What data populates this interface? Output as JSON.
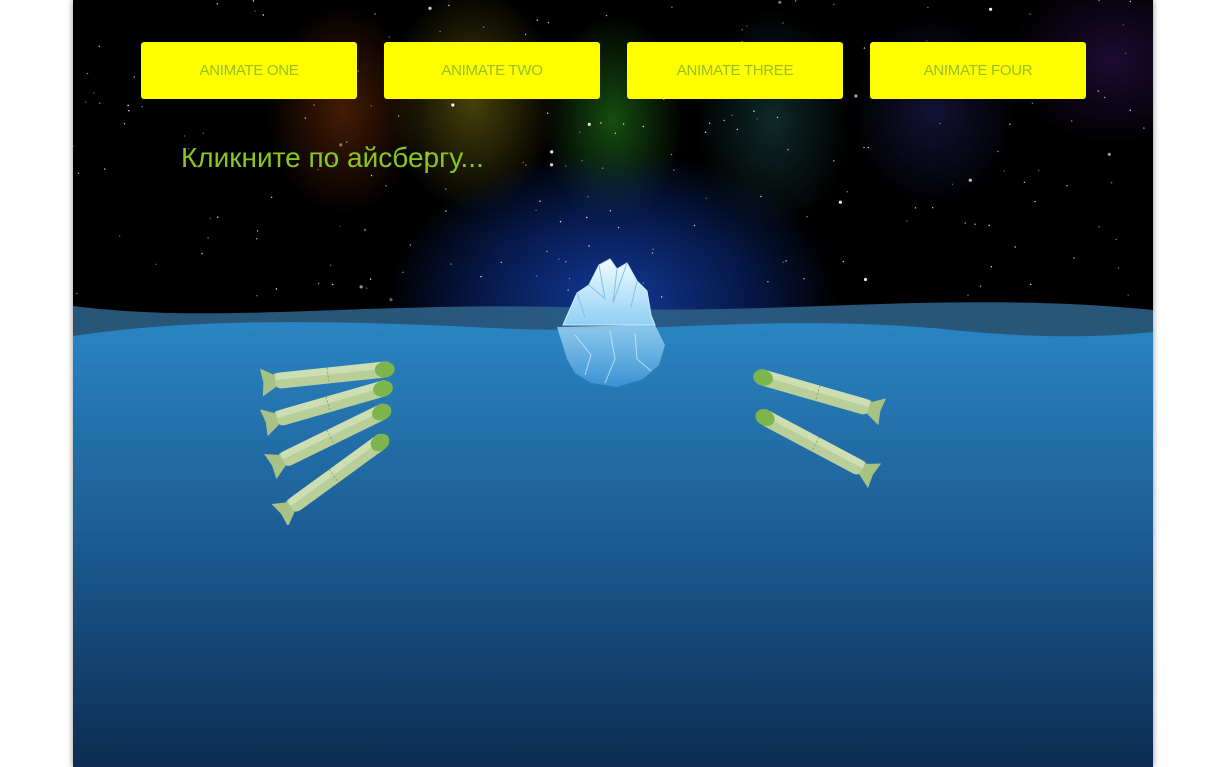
{
  "buttons": [
    {
      "label": "ANIMATE ONE"
    },
    {
      "label": "ANIMATE TWO"
    },
    {
      "label": "ANIMATE THREE"
    },
    {
      "label": "ANIMATE FOUR"
    }
  ],
  "instruction": "Кликните по айсбергу...",
  "colors": {
    "button_bg": "#ffff00",
    "button_text": "#94c21e",
    "headline": "#8bc61c",
    "sea_top": "#2a80bb",
    "sea_bottom": "#0d2f55"
  }
}
